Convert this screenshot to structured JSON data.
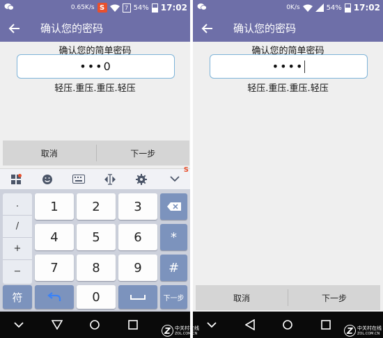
{
  "left": {
    "status": {
      "speed": "0.65K/s",
      "sohu": "S",
      "sim": "7",
      "battery": "54%",
      "time": "17:02"
    },
    "appbar": {
      "title": "确认您的密码"
    },
    "prompt": "确认您的简单密码",
    "password": {
      "masked": "•••",
      "last_char": "0"
    },
    "hint": "轻压.重压.重压.轻压",
    "actions": {
      "cancel": "取消",
      "next": "下一步"
    },
    "keyboard": {
      "toolbar_badge": "S",
      "side": [
        ".",
        "/",
        "+",
        "−"
      ],
      "digits": [
        "1",
        "2",
        "3",
        "4",
        "5",
        "6",
        "7",
        "8",
        "9",
        "0"
      ],
      "star": "*",
      "hash": "#",
      "symbols": "符",
      "next": "下一步"
    }
  },
  "right": {
    "status": {
      "speed": "0K/s",
      "battery": "54%",
      "time": "17:02"
    },
    "appbar": {
      "title": "确认您的密码"
    },
    "prompt": "确认您的简单密码",
    "password": {
      "masked": "••••"
    },
    "hint": "轻压.重压.重压.轻压",
    "actions": {
      "cancel": "取消",
      "next": "下一步"
    }
  },
  "watermark": {
    "logo": "Z",
    "name": "中关村在线",
    "url": "ZOL.COM.CN"
  },
  "colors": {
    "appbar": "#6e6fa8",
    "key_blue": "#7c93bd",
    "field_border": "#7db3d8",
    "sohu": "#e8502e"
  }
}
